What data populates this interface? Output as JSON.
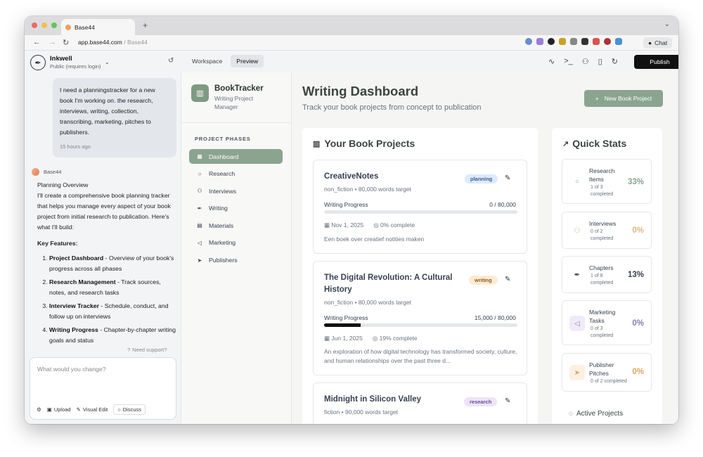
{
  "browser": {
    "tab_title": "Base44",
    "url_host": "app.base44.com",
    "url_path": " / Base44",
    "chat_label": "Chat"
  },
  "chat_panel": {
    "project_name": "Inkwell",
    "project_visibility": "Public (requires login)",
    "user_message": "I need a planningstracker for a new book I'm working on. the research, interviews, writing, collection, transcribing, marketing, pitches to publishers.",
    "user_message_time": "15 hours ago",
    "bot_name": "Base44",
    "reply_heading": "Planning Overview",
    "reply_intro": "I'll create a comprehensive book planning tracker that helps you manage every aspect of your book project from initial research to publication. Here's what I'll build:",
    "key_features_label": "Key Features:",
    "features": [
      {
        "title": "Project Dashboard",
        "text": " - Overview of your book's progress across all phases"
      },
      {
        "title": "Research Management",
        "text": " - Track sources, notes, and research tasks"
      },
      {
        "title": "Interview Tracker",
        "text": " - Schedule, conduct, and follow up on interviews"
      },
      {
        "title": "Writing Progress",
        "text": " - Chapter-by-chapter writing goals and status"
      }
    ],
    "support_label": "Need support?",
    "composer_placeholder": "What would you change?",
    "tools": {
      "upload": "Upload",
      "visual_edit": "Visual Edit",
      "discuss": "Discuss"
    }
  },
  "topbar": {
    "workspace_label": "Workspace",
    "preview_label": "Preview",
    "publish_label": "Publish"
  },
  "app": {
    "brand_title": "BookTracker",
    "brand_subtitle": "Writing Project Manager",
    "phases_label": "PROJECT PHASES",
    "nav": [
      {
        "label": "Dashboard",
        "icon": "grid-icon",
        "active": true
      },
      {
        "label": "Research",
        "icon": "search-icon",
        "active": false
      },
      {
        "label": "Interviews",
        "icon": "users-icon",
        "active": false
      },
      {
        "label": "Writing",
        "icon": "pen-icon",
        "active": false
      },
      {
        "label": "Materials",
        "icon": "file-icon",
        "active": false
      },
      {
        "label": "Marketing",
        "icon": "megaphone-icon",
        "active": false
      },
      {
        "label": "Publishers",
        "icon": "send-icon",
        "active": false
      }
    ],
    "page_title": "Writing Dashboard",
    "page_subtitle": "Track your book projects from concept to publication",
    "new_project_label": "New Book Project",
    "projects_title": "Your Book Projects",
    "progress_label": "Writing Progress",
    "projects": [
      {
        "title": "CreativeNotes",
        "meta": "non_fiction • 80,000 words target",
        "badge": "planning",
        "progress": "0 / 80,000",
        "progress_fraction": 0.0,
        "date": "Nov 1, 2025",
        "complete": "0% complete",
        "description": "Een boek over creatief notities maken"
      },
      {
        "title": "The Digital Revolution: A Cultural History",
        "meta": "non_fiction • 80,000 words target",
        "badge": "writing",
        "progress": "15,000 / 80,000",
        "progress_fraction": 0.19,
        "date": "Jun 1, 2025",
        "complete": "19% complete",
        "description": "An exploration of how digital technology has transformed society, culture, and human relationships over the past three d..."
      },
      {
        "title": "Midnight in Silicon Valley",
        "meta": "fiction • 90,000 words target",
        "badge": "research"
      }
    ],
    "stats_title": "Quick Stats",
    "stats": [
      {
        "name": "Research Items",
        "detail": "1 of 3 completed",
        "percent": "33%",
        "color": "#8aa48f",
        "icon": "search-icon"
      },
      {
        "name": "Interviews",
        "detail": "0 of 2 completed",
        "percent": "0%",
        "color": "#d9b98a",
        "icon": "users-icon"
      },
      {
        "name": "Chapters",
        "detail": "1 of 8 completed",
        "percent": "13%",
        "color": "#374151",
        "icon": "pen-icon"
      },
      {
        "name": "Marketing Tasks",
        "detail": "0 of 3 completed",
        "percent": "0%",
        "color": "#8b7bb0",
        "icon": "megaphone-icon"
      },
      {
        "name": "Publisher Pitches",
        "detail": "0 of 2 completed",
        "percent": "0%",
        "color": "#d9a55a",
        "icon": "send-icon"
      }
    ],
    "active_projects_label": "Active Projects"
  }
}
